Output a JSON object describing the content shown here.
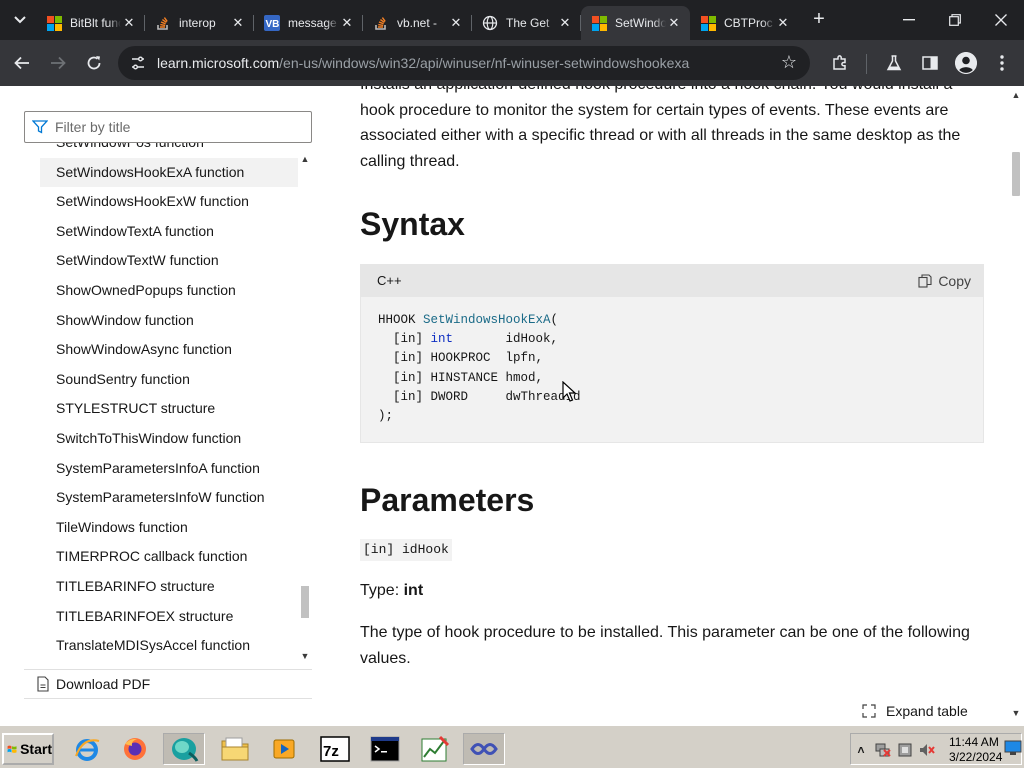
{
  "browser": {
    "tabs": [
      {
        "title": "BitBlt function",
        "favicon": "microsoft-logo-icon"
      },
      {
        "title": "interop",
        "favicon": "stackoverflow-icon"
      },
      {
        "title": "message",
        "favicon": "vb-icon"
      },
      {
        "title": "vb.net -",
        "favicon": "stackoverflow-icon"
      },
      {
        "title": "The Get",
        "favicon": "globe-icon"
      },
      {
        "title": "SetWindowsHookExA",
        "favicon": "microsoft-logo-icon",
        "active": true
      },
      {
        "title": "CBTProc",
        "favicon": "microsoft-logo-icon"
      }
    ],
    "address_bar": {
      "host": "learn.microsoft.com",
      "path": "/en-us/windows/win32/api/winuser/nf-winuser-setwindowshookexa"
    }
  },
  "sidebar": {
    "filter_placeholder": "Filter by title",
    "items": [
      "SetWindowPos function",
      "SetWindowsHookExA function",
      "SetWindowsHookExW function",
      "SetWindowTextA function",
      "SetWindowTextW function",
      "ShowOwnedPopups function",
      "ShowWindow function",
      "ShowWindowAsync function",
      "SoundSentry function",
      "STYLESTRUCT structure",
      "SwitchToThisWindow function",
      "SystemParametersInfoA function",
      "SystemParametersInfoW function",
      "TileWindows function",
      "TIMERPROC callback function",
      "TITLEBARINFO structure",
      "TITLEBARINFOEX structure",
      "TranslateMDISysAccel function"
    ],
    "active_index": 1,
    "download_pdf": "Download PDF"
  },
  "content": {
    "intro": "Installs an application-defined hook procedure into a hook chain. You would install a hook procedure to monitor the system for certain types of events. These events are associated either with a specific thread or with all threads in the same desktop as the calling thread.",
    "syntax_heading": "Syntax",
    "code": {
      "language": "C++",
      "copy_label": "Copy",
      "return_type": "HHOOK",
      "function_name": "SetWindowsHookExA",
      "params": [
        {
          "dir": "[in]",
          "type": "int",
          "name": "idHook",
          "sep": ","
        },
        {
          "dir": "[in]",
          "type": "HOOKPROC",
          "name": "lpfn",
          "sep": ","
        },
        {
          "dir": "[in]",
          "type": "HINSTANCE",
          "name": "hmod",
          "sep": ","
        },
        {
          "dir": "[in]",
          "type": "DWORD",
          "name": "dwThreadId",
          "sep": ""
        }
      ],
      "closing": ");"
    },
    "parameters_heading": "Parameters",
    "param_name": "[in] idHook",
    "type_label": "Type:",
    "type_value": "int",
    "param_description": "The type of hook procedure to be installed. This parameter can be one of the following values.",
    "expand_table": "Expand table"
  },
  "taskbar": {
    "start_label": "Start",
    "clock_time": "11:44 AM",
    "clock_date": "3/22/2024"
  },
  "colors": {
    "accent": "#0078d4",
    "ms_red": "#f25022",
    "ms_green": "#7fba00",
    "ms_blue": "#00a4ef",
    "ms_yellow": "#ffb900"
  }
}
